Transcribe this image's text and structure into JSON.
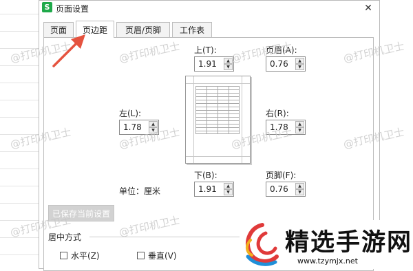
{
  "dialog": {
    "app_icon": "S",
    "title": "页面设置",
    "close_icon": "close-icon"
  },
  "tabs": [
    {
      "label": "页面",
      "active": false
    },
    {
      "label": "页边距",
      "active": true
    },
    {
      "label": "页眉/页脚",
      "active": false
    },
    {
      "label": "工作表",
      "active": false
    }
  ],
  "margins": {
    "top": {
      "label": "上(T):",
      "value": "1.91"
    },
    "header": {
      "label": "页眉(A):",
      "value": "0.76"
    },
    "left": {
      "label": "左(L):",
      "value": "1.78"
    },
    "right": {
      "label": "右(R):",
      "value": "1.78"
    },
    "bottom": {
      "label": "下(B):",
      "value": "1.91"
    },
    "footer": {
      "label": "页脚(F):",
      "value": "0.76"
    }
  },
  "unit_label": "单位：厘米",
  "save_button": "已保存当前设置",
  "center": {
    "title": "居中方式",
    "horizontal": {
      "label": "水平(Z)",
      "checked": false
    },
    "vertical": {
      "label": "垂直(V)",
      "checked": false
    }
  },
  "watermark": "@打印机卫士",
  "logo": {
    "text": "精选手游网",
    "url": "www.tzymjx.net"
  },
  "colors": {
    "app_icon": "#1fa94a",
    "arrow": "#e5533f",
    "save_button_bg": "#d2d2d2"
  }
}
